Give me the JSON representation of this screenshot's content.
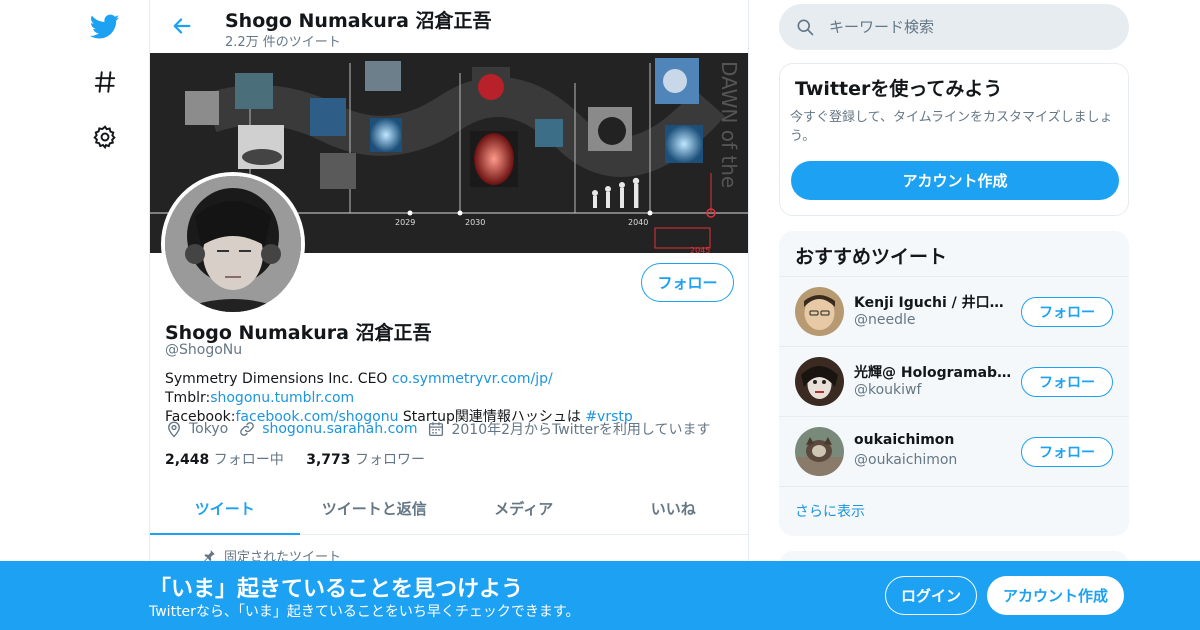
{
  "header": {
    "name": "Shogo Numakura 沼倉正吾",
    "tweet_count": "2.2万 件のツイート"
  },
  "banner": {
    "side_text": "DAWN of the",
    "years": [
      "2029",
      "2030",
      "2040",
      "2045"
    ]
  },
  "profile": {
    "follow_label": "フォロー",
    "name": "Shogo Numakura 沼倉正吾",
    "handle": "@ShogoNu",
    "bio": {
      "t1": "Symmetry Dimensions Inc. CEO ",
      "l1": "co.symmetryvr.com/jp/",
      "t2": " Tmblr:",
      "l2": "shogonu.tumblr.com",
      "t3": " Facebook:",
      "l3": "facebook.com/shogonu",
      "t4": " Startup関連情報ハッシュは ",
      "l4": "#vrstp"
    },
    "location": "Tokyo",
    "website": "shogonu.sarahah.com",
    "joined": "2010年2月からTwitterを利用しています",
    "following_count": "2,448",
    "following_label": "フォロー中",
    "followers_count": "3,773",
    "followers_label": "フォロワー"
  },
  "tabs": [
    "ツイート",
    "ツイートと返信",
    "メディア",
    "いいね"
  ],
  "pinned_label": "固定されたツイート",
  "search": {
    "placeholder": "キーワード検索"
  },
  "signup_card": {
    "title": "Twitterを使ってみよう",
    "desc": "今すぐ登録して、タイムラインをカスタマイズしましょう。",
    "button": "アカウント作成"
  },
  "recommended": {
    "title": "おすすめツイート",
    "users": [
      {
        "name": "Kenji Iguchi / 井口健治",
        "handle": "@needle",
        "follow": "フォロー"
      },
      {
        "name": "光輝@ Hologramable Vtuber",
        "handle": "@koukiwf",
        "follow": "フォロー"
      },
      {
        "name": "oukaichimon",
        "handle": "@oukaichimon",
        "follow": "フォロー"
      }
    ],
    "more": "さらに表示"
  },
  "bottom_bar": {
    "title": "「いま」起きていることを見つけよう",
    "desc": "Twitterなら、「いま」起きていることをいち早くチェックできます。",
    "login": "ログイン",
    "signup": "アカウント作成"
  },
  "colors": {
    "accent": "#1da1f2",
    "link": "#1b95e0",
    "muted": "#657786"
  }
}
